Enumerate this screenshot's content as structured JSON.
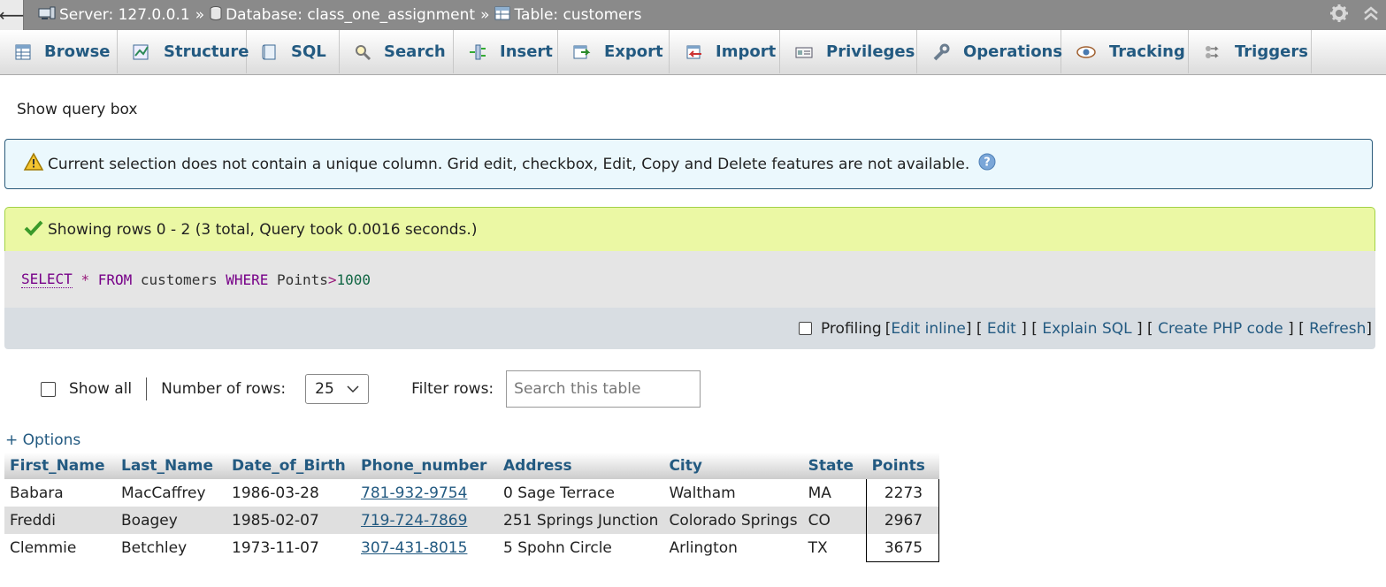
{
  "breadcrumb": {
    "server": "Server: 127.0.0.1",
    "database": "Database: class_one_assignment",
    "table": "Table: customers",
    "separator": "»"
  },
  "tabs": [
    {
      "label": "Browse",
      "icon": "browse-icon"
    },
    {
      "label": "Structure",
      "icon": "structure-icon"
    },
    {
      "label": "SQL",
      "icon": "sql-icon"
    },
    {
      "label": "Search",
      "icon": "search-icon"
    },
    {
      "label": "Insert",
      "icon": "insert-icon"
    },
    {
      "label": "Export",
      "icon": "export-icon"
    },
    {
      "label": "Import",
      "icon": "import-icon"
    },
    {
      "label": "Privileges",
      "icon": "privileges-icon"
    },
    {
      "label": "Operations",
      "icon": "wrench-icon"
    },
    {
      "label": "Tracking",
      "icon": "eye-icon"
    },
    {
      "label": "Triggers",
      "icon": "triggers-icon"
    }
  ],
  "show_query_box": "Show query box",
  "notice": {
    "text": "Current selection does not contain a unique column. Grid edit, checkbox, Edit, Copy and Delete features are not available."
  },
  "success": {
    "text": "Showing rows 0 - 2 (3 total, Query took 0.0016 seconds.)"
  },
  "sql": {
    "select": "SELECT",
    "star": "*",
    "from": "FROM",
    "table": "customers",
    "where": "WHERE",
    "column": "Points",
    "operator": ">",
    "value": "1000"
  },
  "sql_tools": {
    "profiling": "Profiling",
    "edit_inline": "Edit inline",
    "edit": "Edit",
    "explain": "Explain SQL",
    "php": "Create PHP code",
    "refresh": "Refresh"
  },
  "controls": {
    "show_all": "Show all",
    "rows_label": "Number of rows:",
    "rows_value": "25",
    "filter_label": "Filter rows:",
    "filter_placeholder": "Search this table"
  },
  "options_label": "+ Options",
  "table": {
    "columns": [
      "First_Name",
      "Last_Name",
      "Date_of_Birth",
      "Phone_number",
      "Address",
      "City",
      "State",
      "Points"
    ],
    "rows": [
      [
        "Babara",
        "MacCaffrey",
        "1986-03-28",
        "781-932-9754",
        "0 Sage Terrace",
        "Waltham",
        "MA",
        "2273"
      ],
      [
        "Freddi",
        "Boagey",
        "1985-02-07",
        "719-724-7869",
        "251 Springs Junction",
        "Colorado Springs",
        "CO",
        "2967"
      ],
      [
        "Clemmie",
        "Betchley",
        "1973-11-07",
        "307-431-8015",
        "5 Spohn Circle",
        "Arlington",
        "TX",
        "3675"
      ]
    ]
  },
  "colors": {
    "link": "#235a81",
    "topbar": "#8a8a8a",
    "notice_bg": "#ebf8fd",
    "success_bg": "#ebf8a4",
    "sql_bg": "#e5e5e5"
  }
}
